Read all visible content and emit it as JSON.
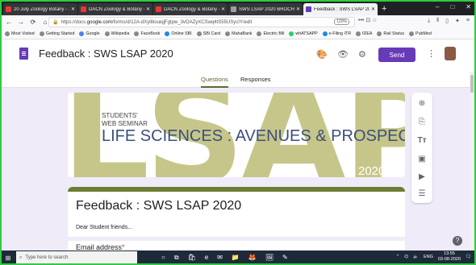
{
  "browser": {
    "tabs": [
      {
        "title": "20 July Zoology Botany - …",
        "favicon_color": "#e53935",
        "active": false
      },
      {
        "title": "DACN Zoology & Botany -",
        "favicon_color": "#e53935",
        "active": false
      },
      {
        "title": "DACN Zoology & Botany -",
        "favicon_color": "#e53935",
        "active": false
      },
      {
        "title": "SWS LSAP 2020 BROCHURE.cd",
        "favicon_color": "#9e9e9e",
        "active": false
      },
      {
        "title": "Feedback : SWS LSAP 2020",
        "favicon_color": "#673ab7",
        "active": true
      }
    ],
    "new_tab_label": "+",
    "window_controls": [
      "–",
      "□",
      "✕"
    ],
    "url_prefix": "https://docs.",
    "url_host": "google.com",
    "url_path": "/forms/d/12A-dXyl8iouiqjFgtpw_3vOAZyXCSwq4tS55USycIY/edit",
    "zoom": "120%",
    "bookmarks": [
      "Most Visited",
      "Getting Started",
      "Google",
      "Wikipedia",
      "FaceBook",
      "Online SBI",
      "SBI Card",
      "MahaBank",
      "Electric Bill",
      "whATSAPP",
      "e-Filing ITR",
      "IDEA",
      "Rail Status",
      "PubMed"
    ]
  },
  "forms": {
    "title": "Feedback : SWS LSAP 2020",
    "send_label": "Send",
    "tabs": {
      "questions": "Questions",
      "responses": "Responses"
    },
    "accent_color": "#673ab7",
    "theme_color": "#6b7d34"
  },
  "banner": {
    "big_text": "LSAP",
    "line1": "STUDENTS'",
    "line2": "WEB SEMINAR",
    "main": "LIFE SCIENCES : AVENUES & PROSPECTS",
    "year": "2020"
  },
  "card": {
    "title": "Feedback : SWS LSAP 2020",
    "description": "Dear Student friends...",
    "first_question": "Email address",
    "required_mark": "*"
  },
  "taskbar": {
    "search_placeholder": "Type here to search",
    "language": "ENG",
    "time": "13:55",
    "date": "03-08-2020"
  }
}
